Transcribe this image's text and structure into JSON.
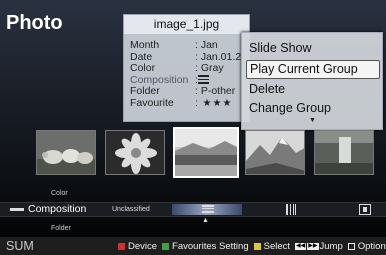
{
  "header": {
    "title": "Photo"
  },
  "info": {
    "filename": "image_1.jpg",
    "rows": [
      {
        "key": "Month",
        "value": ": Jan"
      },
      {
        "key": "Date",
        "value": ": Jan.01.2"
      },
      {
        "key": "Color",
        "value": ": Gray"
      },
      {
        "key": "Composition",
        "value": ":"
      },
      {
        "key": "Folder",
        "value": ": P-other"
      },
      {
        "key": "Favourite",
        "value": ": ★★★"
      }
    ]
  },
  "menu": {
    "items": [
      "Slide Show",
      "Play Current Group",
      "Delete",
      "Change Group"
    ],
    "selected_index": 1
  },
  "thumbnails": {
    "count": 5,
    "selected_index": 2
  },
  "categories": {
    "above": "Color",
    "current": "Composition",
    "below": "Folder",
    "group_label": "Unclassified"
  },
  "bottom": {
    "sum": "SUM",
    "legend": [
      {
        "color": "#d03030",
        "label": "Device"
      },
      {
        "color": "#40a040",
        "label": "Favourites Setting"
      },
      {
        "color": "#d8c840",
        "label": "Select"
      },
      {
        "color": "#3060c0",
        "label": "Jump"
      },
      {
        "color": "#ffffff",
        "label": "Option"
      }
    ]
  },
  "colors": {
    "accent": "#ffffff",
    "panel": "#cdd2da"
  }
}
